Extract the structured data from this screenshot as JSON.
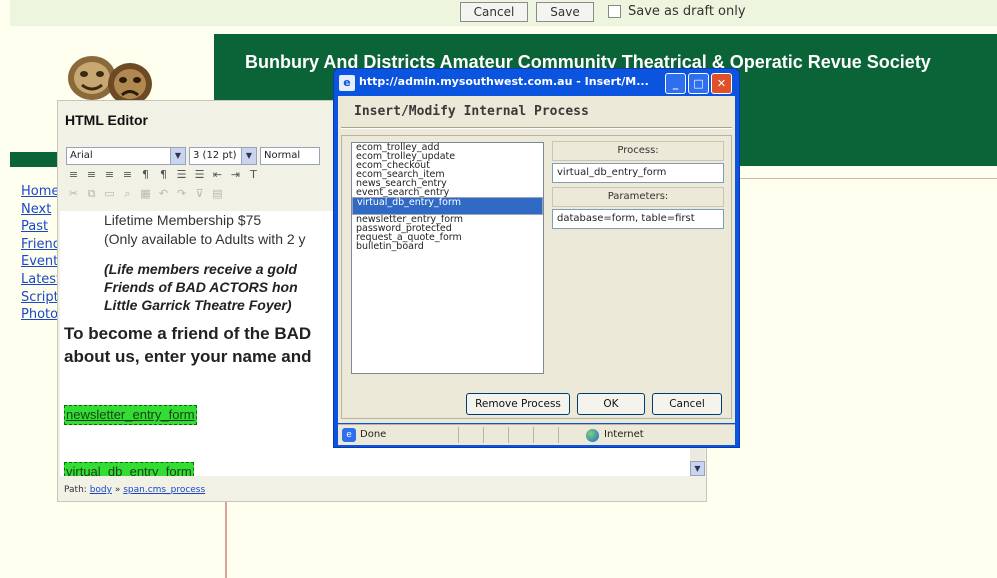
{
  "topbar": {
    "cancel_label": "Cancel",
    "save_label": "Save",
    "draft_label": "Save as draft only"
  },
  "banner": {
    "title": "Bunbury And Districts Amateur Community Theatrical & Operatic Revue Society"
  },
  "sidenav": {
    "items": [
      "Home",
      "Next",
      "Past",
      "Friends",
      "Events",
      "Latest",
      "Scripts",
      "Photos"
    ]
  },
  "editor": {
    "title": "HTML Editor",
    "font_select": "Arial",
    "size_select": "3 (12 pt)",
    "format_select": "Normal",
    "content": {
      "line1": "Lifetime Membership  $75",
      "line2": "(Only available to Adults with 2 y",
      "line3": "(Life members receive a gold",
      "line4": "Friends of BAD ACTORS hon",
      "line5": "Little Garrick Theatre Foyer)",
      "line6": "To become a friend of the BAD",
      "line7": "about us, enter your name and",
      "tag1": "newsletter_entry_form",
      "tag2": "virtual_db_entry_form"
    },
    "path_label": "Path:",
    "path_body": "body",
    "path_sep": "»",
    "path_span": "span.cms_process"
  },
  "dialog": {
    "title": "http://admin.mysouthwest.com.au - Insert/M...",
    "heading": "Insert/Modify Internal Process",
    "processes": [
      "ecom_trolley_add",
      "ecom_trolley_update",
      "ecom_checkout",
      "ecom_search_item",
      "news_search_entry",
      "event_search_entry",
      "virtual_db_entry_form",
      "newsletter_entry_form",
      "password_protected",
      "request_a_quote_form",
      "bulletin_board"
    ],
    "selected_index": 6,
    "process_label": "Process:",
    "process_value": "virtual_db_entry_form",
    "parameters_label": "Parameters:",
    "parameters_value": "database=form, table=first",
    "remove_label": "Remove Process",
    "ok_label": "OK",
    "cancel_label": "Cancel",
    "status_text": "Done",
    "zone_text": "Internet"
  },
  "colors": {
    "banner_green": "#0b6438",
    "xp_blue": "#0a54e0",
    "selection_blue": "#316ac5",
    "tag_green": "#33dd33"
  }
}
